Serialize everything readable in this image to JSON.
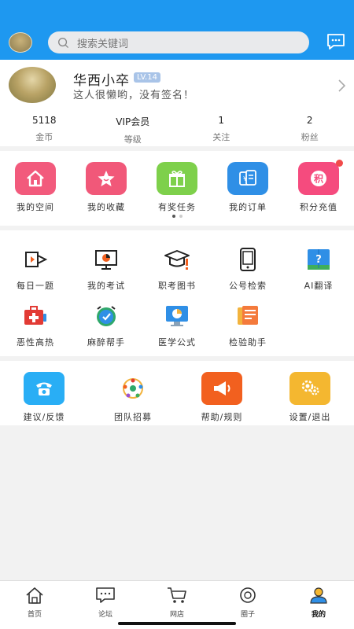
{
  "search": {
    "placeholder": "搜索关键词"
  },
  "profile": {
    "name": "华西小卒",
    "level": "LV.14",
    "signature": "这人很懒哟，没有签名！"
  },
  "stats": [
    {
      "value": "5118",
      "label": "金币"
    },
    {
      "value": "VIP会员",
      "label": "等级"
    },
    {
      "value": "1",
      "label": "关注"
    },
    {
      "value": "2",
      "label": "粉丝"
    }
  ],
  "quick": [
    {
      "label": "我的空间",
      "icon": "home-icon",
      "color": "#f25a7c"
    },
    {
      "label": "我的收藏",
      "icon": "star-icon",
      "color": "#f15879"
    },
    {
      "label": "有奖任务",
      "icon": "gift-icon",
      "color": "#7ed04b"
    },
    {
      "label": "我的订单",
      "icon": "order-icon",
      "color": "#2f8fe6"
    },
    {
      "label": "积分充值",
      "icon": "points-icon",
      "color": "#f54b7e"
    }
  ],
  "tools": [
    {
      "label": "每日一题",
      "icon": "video-icon"
    },
    {
      "label": "我的考试",
      "icon": "exam-icon"
    },
    {
      "label": "职考图书",
      "icon": "graduation-cap-icon"
    },
    {
      "label": "公号检索",
      "icon": "tablet-icon"
    },
    {
      "label": "AI翻译",
      "icon": "book-question-icon"
    },
    {
      "label": "恶性高热",
      "icon": "medkit-icon"
    },
    {
      "label": "麻醉帮手",
      "icon": "alarm-clock-icon"
    },
    {
      "label": "医学公式",
      "icon": "monitor-chart-icon"
    },
    {
      "label": "检验助手",
      "icon": "cards-icon"
    }
  ],
  "more": [
    {
      "label": "建议/反馈",
      "icon": "phone-icon",
      "color": "#29aef5"
    },
    {
      "label": "团队招募",
      "icon": "team-icon",
      "color": "#ffffff"
    },
    {
      "label": "帮助/规则",
      "icon": "megaphone-icon",
      "color": "#f2601f"
    },
    {
      "label": "设置/退出",
      "icon": "settings-user-icon",
      "color": "#f4b730"
    }
  ],
  "tabs": [
    {
      "label": "首页",
      "icon": "home-tab-icon"
    },
    {
      "label": "论坛",
      "icon": "forum-tab-icon"
    },
    {
      "label": "网店",
      "icon": "cart-tab-icon"
    },
    {
      "label": "圈子",
      "icon": "circle-tab-icon"
    },
    {
      "label": "我的",
      "icon": "me-tab-icon",
      "active": true
    }
  ]
}
